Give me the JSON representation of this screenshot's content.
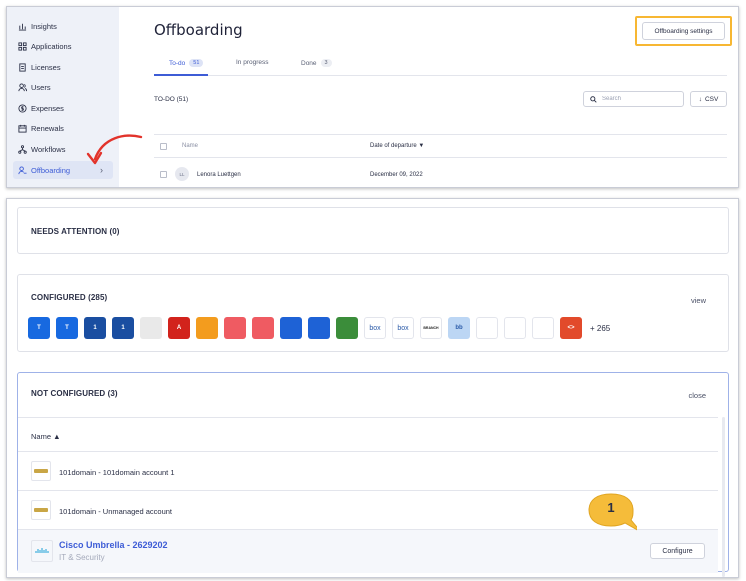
{
  "sidebar": {
    "items": [
      {
        "label": "Insights",
        "icon": "chart-icon"
      },
      {
        "label": "Applications",
        "icon": "grid-icon"
      },
      {
        "label": "Licenses",
        "icon": "document-icon"
      },
      {
        "label": "Users",
        "icon": "users-icon"
      },
      {
        "label": "Expenses",
        "icon": "dollar-icon"
      },
      {
        "label": "Renewals",
        "icon": "calendar-icon"
      },
      {
        "label": "Workflows",
        "icon": "flow-icon"
      },
      {
        "label": "Offboarding",
        "icon": "user-off-icon",
        "active": true
      }
    ]
  },
  "header": {
    "title": "Offboarding",
    "settings_button": "Offboarding settings"
  },
  "tabs": [
    {
      "label": "To-do",
      "count": "51",
      "active": true
    },
    {
      "label": "In progress",
      "count": ""
    },
    {
      "label": "Done",
      "count": "3"
    }
  ],
  "list": {
    "section_label": "TO-DO (51)",
    "search_placeholder": "Search",
    "csv_label": "CSV",
    "columns": {
      "name": "Name",
      "date": "Date of departure ▼"
    },
    "rows": [
      {
        "initials": "LL",
        "name": "Lenora Luettgen",
        "date": "December 09, 2022"
      }
    ]
  },
  "needs_attention": {
    "title": "NEEDS ATTENTION (0)"
  },
  "configured": {
    "title": "CONFIGURED (285)",
    "view_label": "view",
    "more_label": "+ 265",
    "logos": [
      {
        "icon": "app-logo-atlassian-icon",
        "color": "#1769e0",
        "text": "T"
      },
      {
        "icon": "app-logo-atlassian-icon",
        "color": "#1769e0",
        "text": "T"
      },
      {
        "icon": "app-logo-1password-icon",
        "color": "#1a4ea1",
        "text": "1"
      },
      {
        "icon": "app-logo-1password-icon",
        "color": "#1a4ea1",
        "text": "1"
      },
      {
        "icon": "app-logo-generic-icon",
        "color": "#e9e9e9",
        "text": ""
      },
      {
        "icon": "app-logo-adobe-icon",
        "color": "#d2231c",
        "text": "A"
      },
      {
        "icon": "app-logo-aws-icon",
        "color": "#f39c1e",
        "text": ""
      },
      {
        "icon": "app-logo-asana-icon",
        "color": "#ef5b62",
        "text": ""
      },
      {
        "icon": "app-logo-asana-icon",
        "color": "#ef5b62",
        "text": ""
      },
      {
        "icon": "app-logo-atlassian-a-icon",
        "color": "#1e62d6",
        "text": ""
      },
      {
        "icon": "app-logo-atlassian-a-icon",
        "color": "#1e62d6",
        "text": ""
      },
      {
        "icon": "app-logo-tree-icon",
        "color": "#3b8d3a",
        "text": ""
      },
      {
        "icon": "app-logo-box-icon",
        "color": "#ffffff",
        "text": "box"
      },
      {
        "icon": "app-logo-box-icon",
        "color": "#ffffff",
        "text": "box"
      },
      {
        "icon": "app-logo-branch-icon",
        "color": "#ffffff",
        "text": "BRANCH"
      },
      {
        "icon": "app-logo-bb-icon",
        "color": "#bcd6f4",
        "text": "bb"
      },
      {
        "icon": "app-logo-circle-icon",
        "color": "#ffffff",
        "text": ""
      },
      {
        "icon": "app-logo-cloudflare-icon",
        "color": "#ffffff",
        "text": ""
      },
      {
        "icon": "app-logo-cloud-icon",
        "color": "#ffffff",
        "text": ""
      },
      {
        "icon": "app-logo-code-icon",
        "color": "#e24a2b",
        "text": "<>"
      }
    ]
  },
  "not_configured": {
    "title": "NOT CONFIGURED (3)",
    "close_label": "close",
    "column": "Name ▲",
    "rows": [
      {
        "name": "101domain - 101domain account 1"
      },
      {
        "name": "101domain - Unmanaged account"
      },
      {
        "name": "Cisco Umbrella - 2629202",
        "category": "IT & Security",
        "button": "Configure"
      }
    ]
  },
  "annotation": {
    "step": "1"
  },
  "colors": {
    "accent": "#3d5cd6",
    "highlight": "#f7b733",
    "arrow": "#e2332b"
  }
}
